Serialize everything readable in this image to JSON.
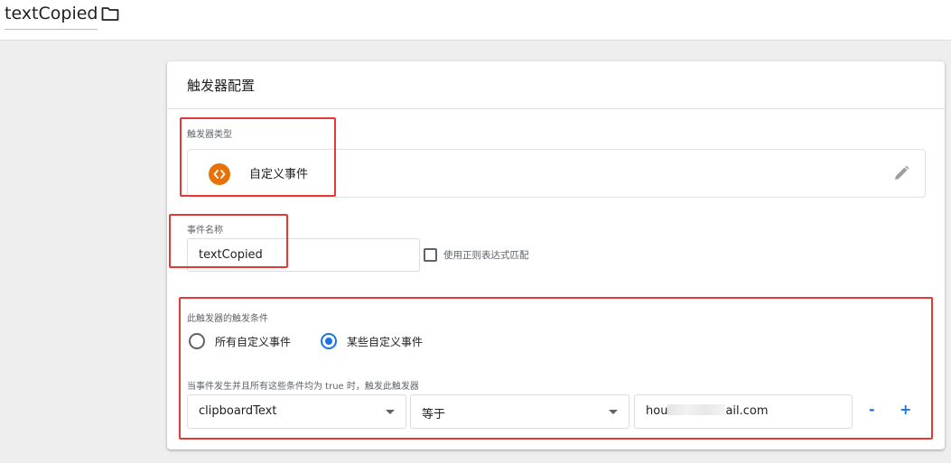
{
  "header": {
    "title": "textCopied",
    "folder_icon": "folder-icon"
  },
  "trigger_config": {
    "title": "触发器配置",
    "type_section": {
      "label": "触发器类型",
      "type_name": "自定义事件",
      "type_icon": "code-brackets-icon",
      "icon_color": "#e8710a"
    },
    "event_section": {
      "label": "事件名称",
      "event_name_value": "textCopied",
      "regex_checkbox_label": "使用正则表达式匹配",
      "regex_checked": false
    },
    "fire_section": {
      "label": "此触发器的触发条件",
      "options": [
        {
          "label": "所有自定义事件",
          "checked": false
        },
        {
          "label": "某些自定义事件",
          "checked": true
        }
      ],
      "condition_label": "当事件发生并且所有这些条件均为 true 时，触发此触发器",
      "condition": {
        "variable": "clipboardText",
        "operator": "等于",
        "value_prefix": "hou",
        "value_suffix": "ail.com"
      },
      "remove_label": "-",
      "add_label": "+"
    }
  },
  "colors": {
    "accent": "#1a73e8",
    "highlight": "#e53935"
  }
}
